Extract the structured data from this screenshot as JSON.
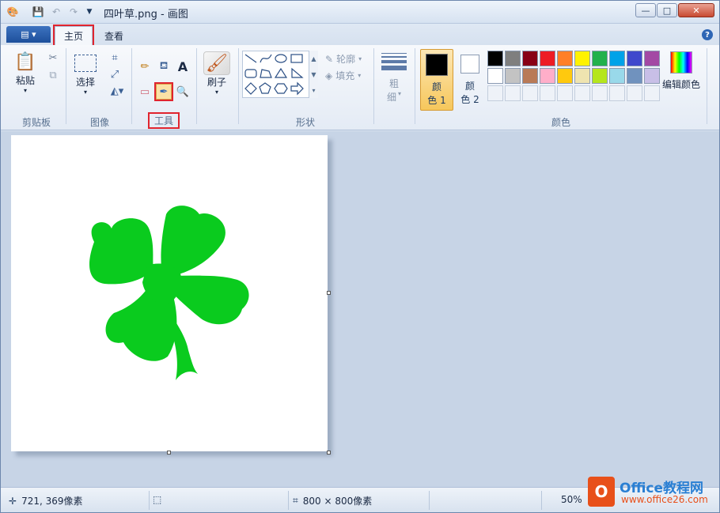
{
  "window": {
    "title": "四叶草.png - 画图",
    "controls": {
      "minimize": "—",
      "maximize": "□",
      "close": "✕"
    }
  },
  "tabs": {
    "home": "主页",
    "view": "查看"
  },
  "ribbon": {
    "clipboard": {
      "paste": "粘贴",
      "group": "剪贴板"
    },
    "image": {
      "select": "选择",
      "group": "图像"
    },
    "tools": {
      "group": "工具"
    },
    "brushes": {
      "label": "刷子"
    },
    "shapes": {
      "outline": "轮廓",
      "fill": "填充",
      "group": "形状"
    },
    "size": {
      "label1": "粗",
      "label2": "细"
    },
    "colors": {
      "color1_a": "颜",
      "color1_b": "色 1",
      "color2_a": "颜",
      "color2_b": "色 2",
      "edit": "编辑颜色",
      "group": "颜色",
      "palette_row1": [
        "#000000",
        "#7f7f7f",
        "#880015",
        "#ed1c24",
        "#ff7f27",
        "#fff200",
        "#22b14c",
        "#00a2e8",
        "#3f48cc",
        "#a349a4"
      ],
      "palette_row2": [
        "#ffffff",
        "#c3c3c3",
        "#b97a57",
        "#ffaec9",
        "#ffc90e",
        "#efe4b0",
        "#b5e61d",
        "#99d9ea",
        "#7092be",
        "#c8bfe7"
      ]
    }
  },
  "status": {
    "cursor_pos": "721, 369像素",
    "image_size": "800 × 800像素",
    "zoom": "50%"
  },
  "watermark": {
    "brand": "Office教程网",
    "url": "www.office26.com"
  },
  "colors": {
    "clover": "#0acb1e",
    "highlight": "#e0242e"
  }
}
